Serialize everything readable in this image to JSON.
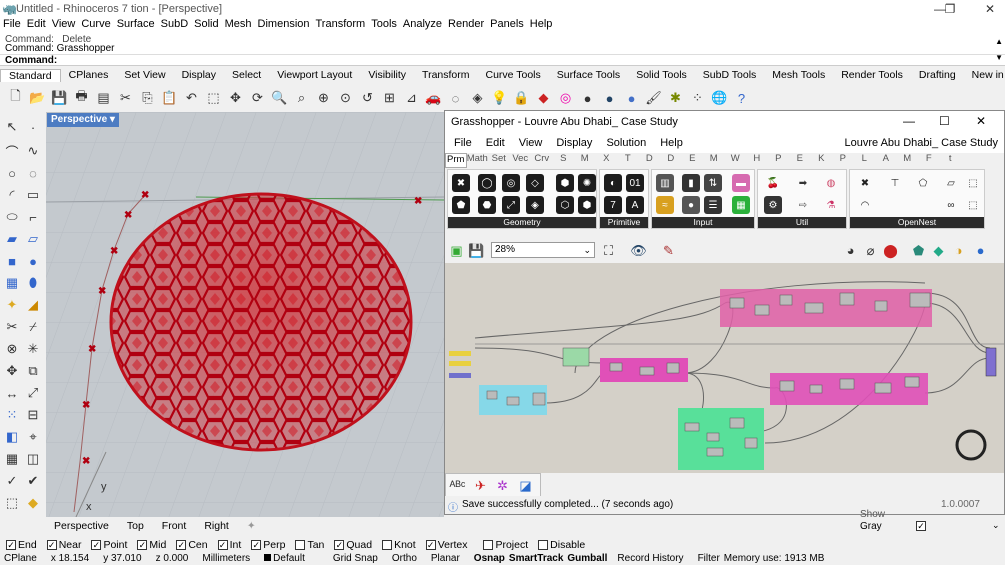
{
  "window": {
    "title": "Untitled - Rhinoceros 7 tion - [Perspective]"
  },
  "menu": [
    "File",
    "Edit",
    "View",
    "Curve",
    "Surface",
    "SubD",
    "Solid",
    "Mesh",
    "Dimension",
    "Transform",
    "Tools",
    "Analyze",
    "Render",
    "Panels",
    "Help"
  ],
  "command": {
    "line1": "Command: _Delete",
    "line2": "Command: Grasshopper",
    "prompt": "Command:"
  },
  "tabs": [
    "Standard",
    "CPlanes",
    "Set View",
    "Display",
    "Select",
    "Viewport Layout",
    "Visibility",
    "Transform",
    "Curve Tools",
    "Surface Tools",
    "Solid Tools",
    "SubD Tools",
    "Mesh Tools",
    "Render Tools",
    "Drafting",
    "New in V"
  ],
  "viewport": {
    "label": "Perspective",
    "axis_x": "x",
    "axis_y": "y"
  },
  "viewport_tabs": [
    "Perspective",
    "Top",
    "Front",
    "Right"
  ],
  "gh": {
    "title": "Grasshopper - Louvre Abu Dhabi_ Case Study",
    "menu": [
      "File",
      "Edit",
      "View",
      "Display",
      "Solution",
      "Help"
    ],
    "doc_name": "Louvre Abu Dhabi_ Case Study",
    "tabs": [
      "Prm",
      "Math",
      "Set",
      "Vec",
      "Crv",
      "S",
      "M",
      "X",
      "T",
      "D",
      "D",
      "E",
      "M",
      "W",
      "H",
      "P",
      "E",
      "K",
      "P",
      "L",
      "A",
      "M",
      "F",
      "t"
    ],
    "groups": [
      "Geometry",
      "Primitive",
      "Input",
      "Util",
      "OpenNest"
    ],
    "zoom": "28%",
    "status": "Save successfully completed... (7 seconds ago)",
    "version": "1.0.0007"
  },
  "layers": {
    "row1": "Show",
    "row2": "Gray"
  },
  "osnap": [
    "End",
    "Near",
    "Point",
    "Mid",
    "Cen",
    "Int",
    "Perp",
    "Tan",
    "Quad",
    "Knot",
    "Vertex",
    "Project",
    "Disable"
  ],
  "osnap_checked": [
    true,
    true,
    true,
    true,
    true,
    true,
    true,
    false,
    true,
    false,
    true,
    false,
    false
  ],
  "status": {
    "cplane": "CPlane",
    "x": "x 18.154",
    "y": "y 37.010",
    "z": "z 0.000",
    "units": "Millimeters",
    "layer": "Default",
    "grid": "Grid Snap",
    "ortho": "Ortho",
    "planar": "Planar",
    "osnap": "Osnap",
    "smart": "SmartTrack",
    "gumball": "Gumball",
    "history": "Record History",
    "filter": "Filter",
    "memory": "Memory use: 1913 MB"
  },
  "colors": {
    "accent": "#4d7cc2",
    "dome": "#c8101a",
    "pink": "#e060a8",
    "cyan": "#86d8e8",
    "green": "#58e09a"
  }
}
